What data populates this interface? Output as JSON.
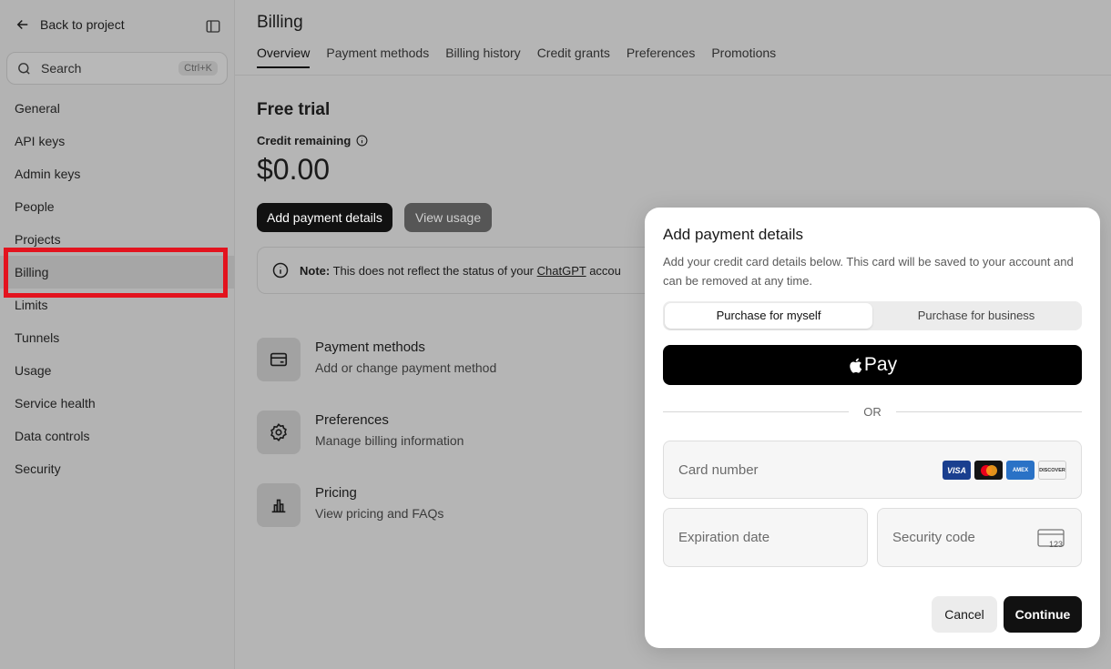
{
  "sidebar": {
    "back_label": "Back to project",
    "search_placeholder": "Search",
    "search_shortcut": "Ctrl+K",
    "items": [
      {
        "label": "General"
      },
      {
        "label": "API keys"
      },
      {
        "label": "Admin keys"
      },
      {
        "label": "People"
      },
      {
        "label": "Projects"
      },
      {
        "label": "Billing"
      },
      {
        "label": "Limits"
      },
      {
        "label": "Tunnels"
      },
      {
        "label": "Usage"
      },
      {
        "label": "Service health"
      },
      {
        "label": "Data controls"
      },
      {
        "label": "Security"
      }
    ],
    "active_item": "Billing"
  },
  "main": {
    "title": "Billing",
    "tabs": [
      {
        "label": "Overview"
      },
      {
        "label": "Payment methods"
      },
      {
        "label": "Billing history"
      },
      {
        "label": "Credit grants"
      },
      {
        "label": "Preferences"
      },
      {
        "label": "Promotions"
      }
    ],
    "section_title": "Free trial",
    "credit_label": "Credit remaining",
    "credit_amount": "$0.00",
    "add_payment_label": "Add payment details",
    "view_usage_label": "View usage",
    "note": {
      "prefix": "Note:",
      "text": "This does not reflect the status of your",
      "link": "ChatGPT",
      "suffix": "accou"
    },
    "cards": [
      {
        "title": "Payment methods",
        "subtitle": "Add or change payment method",
        "icon": "card-icon"
      },
      {
        "title": "Preferences",
        "subtitle": "Manage billing information",
        "icon": "gear-icon"
      },
      {
        "title": "Pricing",
        "subtitle": "View pricing and FAQs",
        "icon": "bar-chart-icon"
      }
    ]
  },
  "modal": {
    "title": "Add payment details",
    "description": "Add your credit card details below. This card will be saved to your account and can be removed at any time.",
    "segments": [
      {
        "label": "Purchase for myself"
      },
      {
        "label": "Purchase for business"
      }
    ],
    "selected_segment": "Purchase for myself",
    "apple_pay_label": "Pay",
    "or_label": "OR",
    "card_number_placeholder": "Card number",
    "expiration_placeholder": "Expiration date",
    "security_placeholder": "Security code",
    "brands": [
      "VISA",
      "",
      "AMEX",
      "DISCOVER"
    ],
    "cvc_hint": "123",
    "cancel_label": "Cancel",
    "continue_label": "Continue"
  }
}
